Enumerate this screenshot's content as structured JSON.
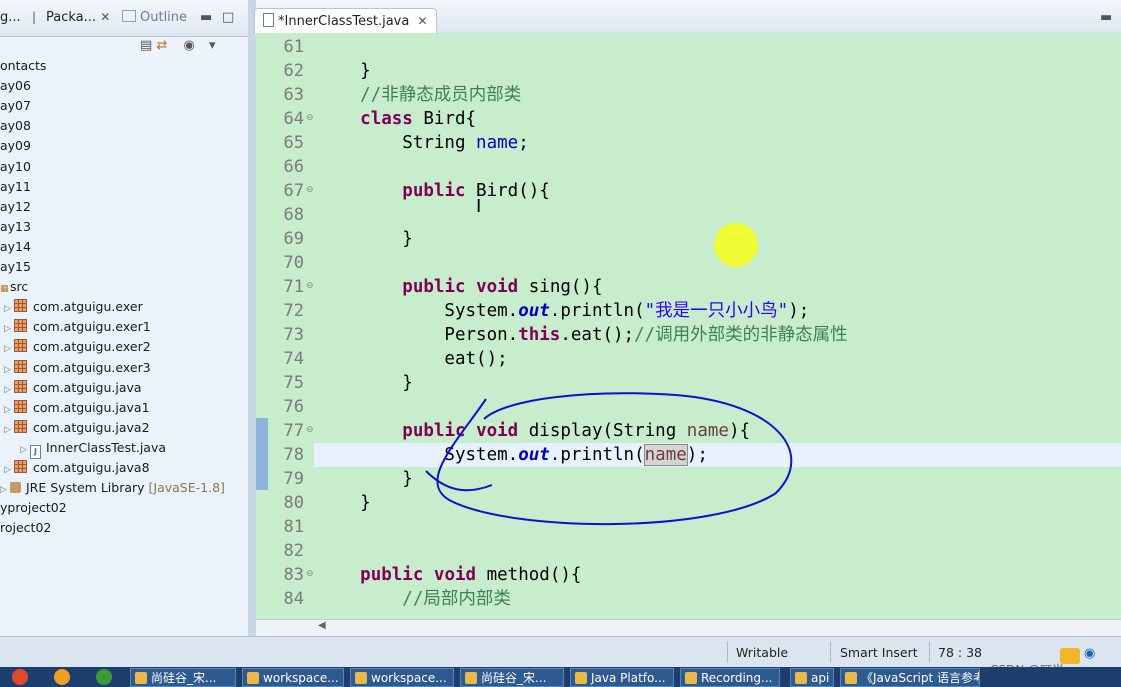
{
  "left_panel": {
    "tabs": [
      {
        "label": "g...",
        "close": ""
      },
      {
        "label": "Packa...",
        "close": "✕"
      },
      {
        "label": "Outline",
        "close": ""
      }
    ],
    "tree": [
      {
        "label": "ontacts",
        "kind": "folder"
      },
      {
        "label": "ay06",
        "kind": "folder"
      },
      {
        "label": "ay07",
        "kind": "folder"
      },
      {
        "label": "ay08",
        "kind": "folder"
      },
      {
        "label": "ay09",
        "kind": "folder"
      },
      {
        "label": "ay10",
        "kind": "folder"
      },
      {
        "label": "ay11",
        "kind": "folder"
      },
      {
        "label": "ay12",
        "kind": "folder"
      },
      {
        "label": "ay13",
        "kind": "folder"
      },
      {
        "label": "ay14",
        "kind": "folder"
      },
      {
        "label": "ay15",
        "kind": "folder"
      },
      {
        "label": "src",
        "kind": "src"
      },
      {
        "label": "com.atguigu.exer",
        "kind": "package"
      },
      {
        "label": "com.atguigu.exer1",
        "kind": "package"
      },
      {
        "label": "com.atguigu.exer2",
        "kind": "package"
      },
      {
        "label": "com.atguigu.exer3",
        "kind": "package"
      },
      {
        "label": "com.atguigu.java",
        "kind": "package"
      },
      {
        "label": "com.atguigu.java1",
        "kind": "package"
      },
      {
        "label": "com.atguigu.java2",
        "kind": "package"
      },
      {
        "label": "InnerClassTest.java",
        "kind": "file"
      },
      {
        "label": "com.atguigu.java8",
        "kind": "package"
      },
      {
        "label": "JRE System Library",
        "suffix": "[JavaSE-1.8]",
        "kind": "jre"
      },
      {
        "label": "yproject02",
        "kind": "folder"
      },
      {
        "label": "roject02",
        "kind": "folder"
      }
    ]
  },
  "editor": {
    "tab_label": "*InnerClassTest.java",
    "tab_close": "✕",
    "lines": [
      {
        "n": "61",
        "code": ""
      },
      {
        "n": "62",
        "code": "    }"
      },
      {
        "n": "63",
        "code": "    //非静态成员内部类"
      },
      {
        "n": "64",
        "code": "    class Bird{"
      },
      {
        "n": "65",
        "code": "        String name;"
      },
      {
        "n": "66",
        "code": ""
      },
      {
        "n": "67",
        "code": "        public Bird(){"
      },
      {
        "n": "68",
        "code": ""
      },
      {
        "n": "69",
        "code": "        }"
      },
      {
        "n": "70",
        "code": ""
      },
      {
        "n": "71",
        "code": "        public void sing(){"
      },
      {
        "n": "72",
        "code": "            System.out.println(\"我是一只小小鸟\");"
      },
      {
        "n": "73",
        "code": "            Person.this.eat();//调用外部类的非静态属性"
      },
      {
        "n": "74",
        "code": "            eat();"
      },
      {
        "n": "75",
        "code": "        }"
      },
      {
        "n": "76",
        "code": ""
      },
      {
        "n": "77",
        "code": "        public void display(String name){"
      },
      {
        "n": "78",
        "code": "            System.out.println(name);"
      },
      {
        "n": "79",
        "code": "        }"
      },
      {
        "n": "80",
        "code": "    }"
      },
      {
        "n": "81",
        "code": ""
      },
      {
        "n": "82",
        "code": ""
      },
      {
        "n": "83",
        "code": "    public void method(){"
      },
      {
        "n": "84",
        "code": "        //局部内部类"
      }
    ]
  },
  "status_bar": {
    "writable": "Writable",
    "insert_mode": "Smart Insert",
    "position": "78 : 38"
  },
  "watermark": "CSDN @叮当…",
  "taskbar": {
    "items": [
      "尚硅谷_宋...",
      "workspace...",
      "workspace...",
      "尚硅谷_宋...",
      "Java Platfo...",
      "Recording...",
      "api",
      "《JavaScript 语言参考..."
    ]
  },
  "colors": {
    "editor_bg": "#c7edcc",
    "keyword": "#7f0055",
    "comment": "#3f7f5f",
    "string": "#2a00ff",
    "field": "#0000c0",
    "annotation_ink": "#1010d0"
  }
}
